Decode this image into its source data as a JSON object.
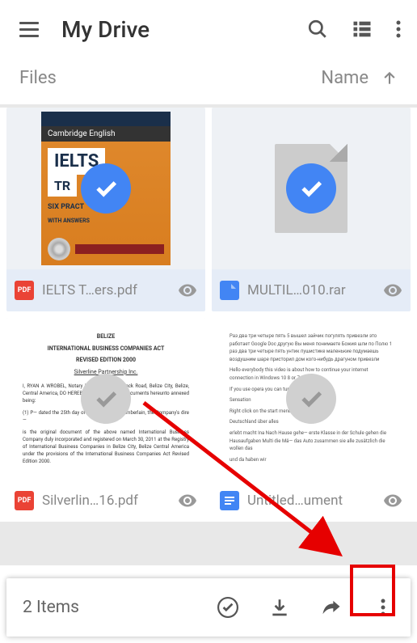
{
  "header": {
    "title": "My Drive"
  },
  "subheader": {
    "section_label": "Files",
    "sort_label": "Name"
  },
  "files": [
    {
      "name": "IELTS T…ers.pdf",
      "type": "pdf",
      "selected": true
    },
    {
      "name": "MULTIL…010.rar",
      "type": "file",
      "selected": true
    },
    {
      "name": "Silverlin…16.pdf",
      "type": "pdf",
      "selected": false
    },
    {
      "name": "Untitled…ument",
      "type": "doc",
      "selected": false
    }
  ],
  "thumb_text": {
    "ielts_band": "Cambridge English",
    "ielts_title": "IELTS",
    "ielts_tr": "TR",
    "ielts_sub1": "SIX PRACT",
    "ielts_sub2": "WITH ANSWERS",
    "belize_t1": "BELIZE",
    "belize_t2": "INTERNATIONAL BUSINESS COMPANIES ACT",
    "belize_t3": "REVISED EDITION 2000",
    "belize_sub": "Silverline Partnership Inc.",
    "belize_p1": "I, RYAN A WROBEL, Notary Public of 115 Barrack Road, Belize City, Belize, Central America, DO HEREBY CERTIFY that the documents hereunto annexed being:",
    "belize_p2": "(1) P— dated the 25th day of March, 20— a Chamberlain, the Company's dire—",
    "belize_p3": "is the original document of the above named International Business Company duly incorporated and registered on March 30, 2011 at the Registry of International Business Companies in Belize City, Belize Central America under the provisions of the International Business Companies Act Revised Edition 2000.",
    "untitled_p1": "Раз два три четыре пять 5 вышел зайчик погулять привезли это работает Google Doc другую Вы меня понимаете Божия шли по Полю 1 раз два три четыре пять унтик пушистике маленькие подумаешь воздушним шаре присторил дом кого-нибудь драгуном привезли",
    "untitled_p2": "Hello everybody this video is about how to continue your internet connection in Windows 10 8 or 7",
    "untitled_p3": "If you use opera you can turn turbo",
    "untitled_p4": "Sensation",
    "untitled_p5": "Right click on the start menu",
    "untitled_p6": "Deutschland über alles",
    "untitled_p7": "erlebt macht Ina Nach Hause gehe— erste Klasse in der Schule gehen die Hausaufgaben Multi die Mä— das Auto zusammen sie alle zusätzlich die wollen das",
    "untitled_p8": "und da haben wir"
  },
  "actionbar": {
    "count_label": "2 Items"
  }
}
